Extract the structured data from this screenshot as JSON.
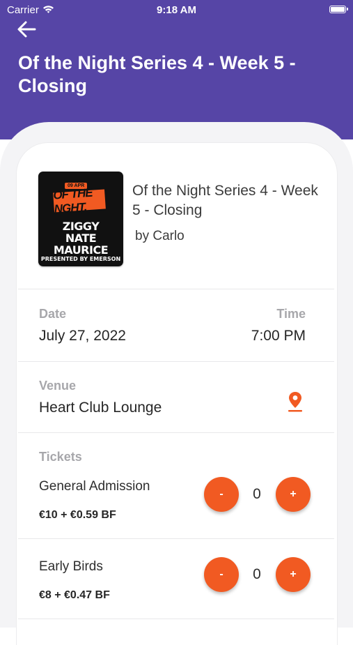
{
  "status_bar": {
    "carrier": "Carrier",
    "time": "9:18 AM"
  },
  "header": {
    "title": "Of the Night Series 4 - Week 5 - Closing",
    "background_color": "#5645a6",
    "back_icon": "arrow-left-icon"
  },
  "event": {
    "name": "Of the Night Series 4 - Week 5 - Closing",
    "organizer": "by Carlo",
    "poster": {
      "date": "09 APR",
      "brand": "OF THE NGHT.",
      "lineup": [
        "ZIGGY",
        "NATE",
        "MAURICE"
      ],
      "presenter": "PRESENTED BY EMERSON"
    }
  },
  "details": {
    "date_label": "Date",
    "date_value": "July 27, 2022",
    "time_label": "Time",
    "time_value": "7:00 PM",
    "venue_label": "Venue",
    "venue_value": "Heart Club Lounge",
    "venue_icon": "map-pin-icon"
  },
  "tickets": {
    "label": "Tickets",
    "items": [
      {
        "name": "General Admission",
        "price": "€10 + €0.59 BF",
        "quantity": "0",
        "minus_label": "-",
        "plus_label": "+"
      },
      {
        "name": "Early Birds",
        "price": "€8 + €0.47 BF",
        "quantity": "0",
        "minus_label": "-",
        "plus_label": "+"
      }
    ]
  },
  "colors": {
    "accent": "#f15a22",
    "header": "#5645a6",
    "label_gray": "#a7a7ab"
  }
}
